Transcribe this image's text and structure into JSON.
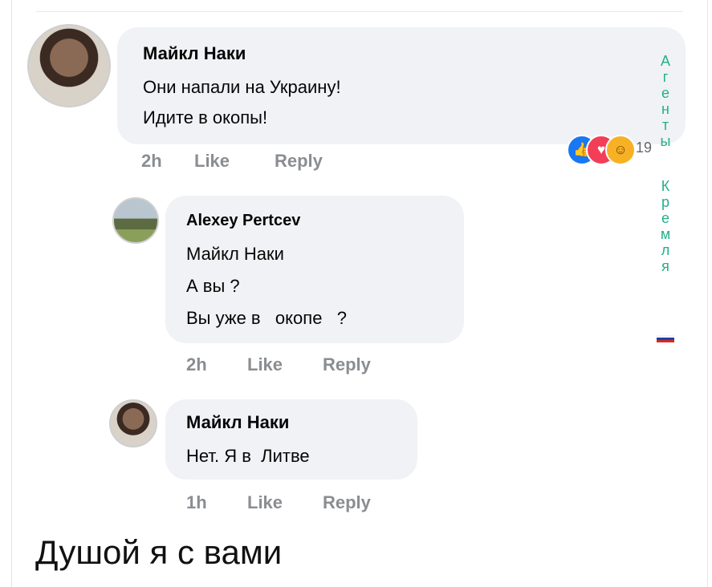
{
  "comments": [
    {
      "author": "Майкл Наки",
      "lines": [
        "Они напали на Украину!",
        "Идите в окопы!"
      ],
      "time": "2h",
      "like_label": "Like",
      "reply_label": "Reply",
      "reaction_count": "19"
    },
    {
      "author": "Alexey Pertcev",
      "lines": [
        "Майкл Наки",
        "А вы ?",
        "Вы уже в   окопе   ?"
      ],
      "time": "2h",
      "like_label": "Like",
      "reply_label": "Reply"
    },
    {
      "author": "Майкл Наки",
      "lines": [
        "Нет. Я в  Литве"
      ],
      "time": "1h",
      "like_label": "Like",
      "reply_label": "Reply"
    }
  ],
  "reactions": [
    "like-icon",
    "love-icon",
    "haha-icon"
  ],
  "vertical_text": [
    "А",
    "г",
    "е",
    "н",
    "т",
    "ы",
    "",
    "К",
    "р",
    "е",
    "м",
    "л",
    "я"
  ],
  "flag_colors": [
    "#ffffff",
    "#1c3fb5",
    "#d52b1e"
  ],
  "caption": "Душой я с вами",
  "colors": {
    "bubble": "#f0f2f5",
    "meta": "#8a8d91",
    "vertical": "#23b08a"
  }
}
